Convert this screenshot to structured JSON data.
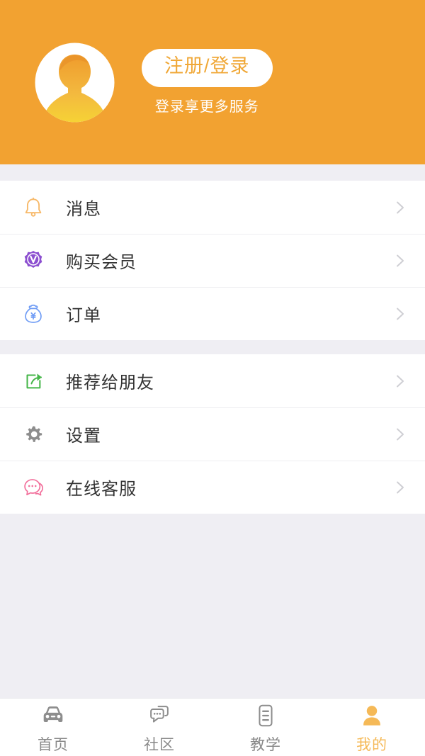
{
  "header": {
    "background_color": "#f2a231",
    "avatar_icon": "user-avatar-placeholder-icon",
    "login_button_label": "注册/登录",
    "login_button_text_color": "#f0a838",
    "subtitle": "登录享更多服务"
  },
  "menu_groups": [
    {
      "items": [
        {
          "label": "消息",
          "icon": "bell-icon",
          "icon_color": "#f7b96a",
          "chevron": "chevron-right-icon"
        },
        {
          "label": "购买会员",
          "icon": "vip-badge-icon",
          "icon_color": "#8c4fd0",
          "chevron": "chevron-right-icon"
        },
        {
          "label": "订单",
          "icon": "money-bag-icon",
          "icon_color": "#6f9cf5",
          "chevron": "chevron-right-icon"
        }
      ]
    },
    {
      "items": [
        {
          "label": "推荐给朋友",
          "icon": "share-icon",
          "icon_color": "#45b649",
          "chevron": "chevron-right-icon"
        },
        {
          "label": "设置",
          "icon": "gear-icon",
          "icon_color": "#8d8d8d",
          "chevron": "chevron-right-icon"
        },
        {
          "label": "在线客服",
          "icon": "chat-support-icon",
          "icon_color": "#f2709c",
          "chevron": "chevron-right-icon"
        }
      ]
    }
  ],
  "tabbar": {
    "active_color": "#f5b957",
    "inactive_color": "#8d8d8d",
    "tabs": [
      {
        "label": "首页",
        "icon": "car-icon",
        "active": "false"
      },
      {
        "label": "社区",
        "icon": "chat-bubbles-icon",
        "active": "false"
      },
      {
        "label": "教学",
        "icon": "document-lines-icon",
        "active": "false"
      },
      {
        "label": "我的",
        "icon": "person-icon",
        "active": "true"
      }
    ]
  }
}
